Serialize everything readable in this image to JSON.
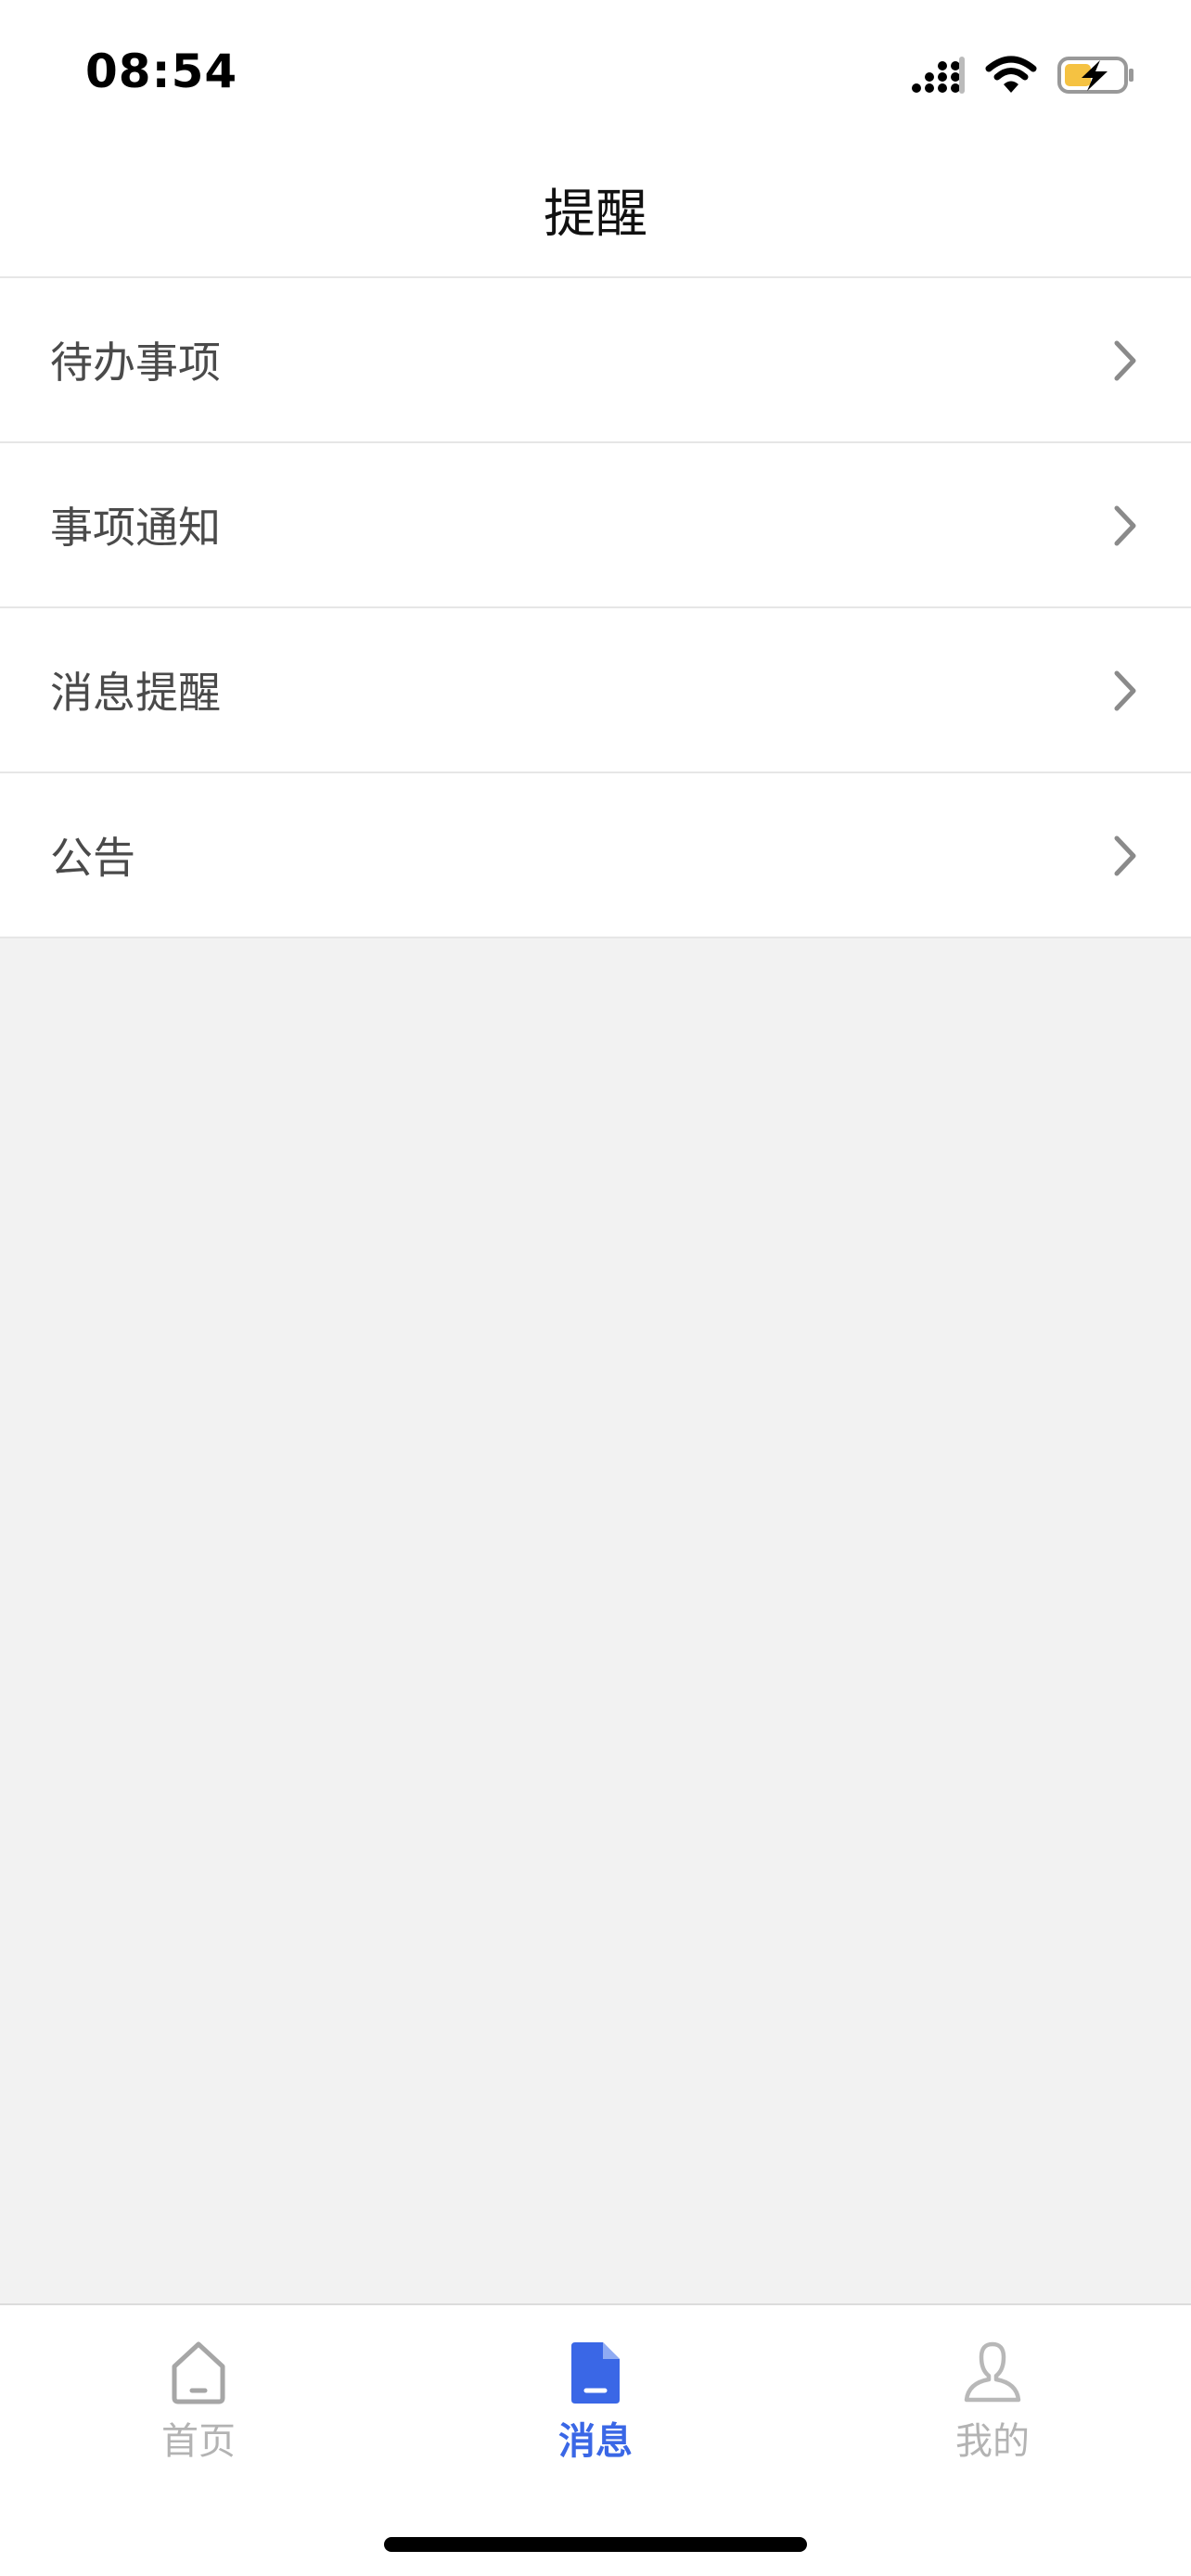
{
  "status_bar": {
    "time": "08:54",
    "icons": [
      "signal-icon",
      "wifi-icon",
      "battery-charging-icon"
    ],
    "battery_color": "#f5c242"
  },
  "nav": {
    "title": "提醒"
  },
  "list": {
    "items": [
      {
        "label": "待办事项",
        "icon": "chevron-right-icon"
      },
      {
        "label": "事项通知",
        "icon": "chevron-right-icon"
      },
      {
        "label": "消息提醒",
        "icon": "chevron-right-icon"
      },
      {
        "label": "公告",
        "icon": "chevron-right-icon"
      }
    ]
  },
  "tab_bar": {
    "tabs": [
      {
        "label": "首页",
        "icon": "home-icon",
        "active": false
      },
      {
        "label": "消息",
        "icon": "message-document-icon",
        "active": true
      },
      {
        "label": "我的",
        "icon": "user-icon",
        "active": false
      }
    ],
    "active_color": "#3a67e6",
    "inactive_color": "#b3b3b3"
  }
}
